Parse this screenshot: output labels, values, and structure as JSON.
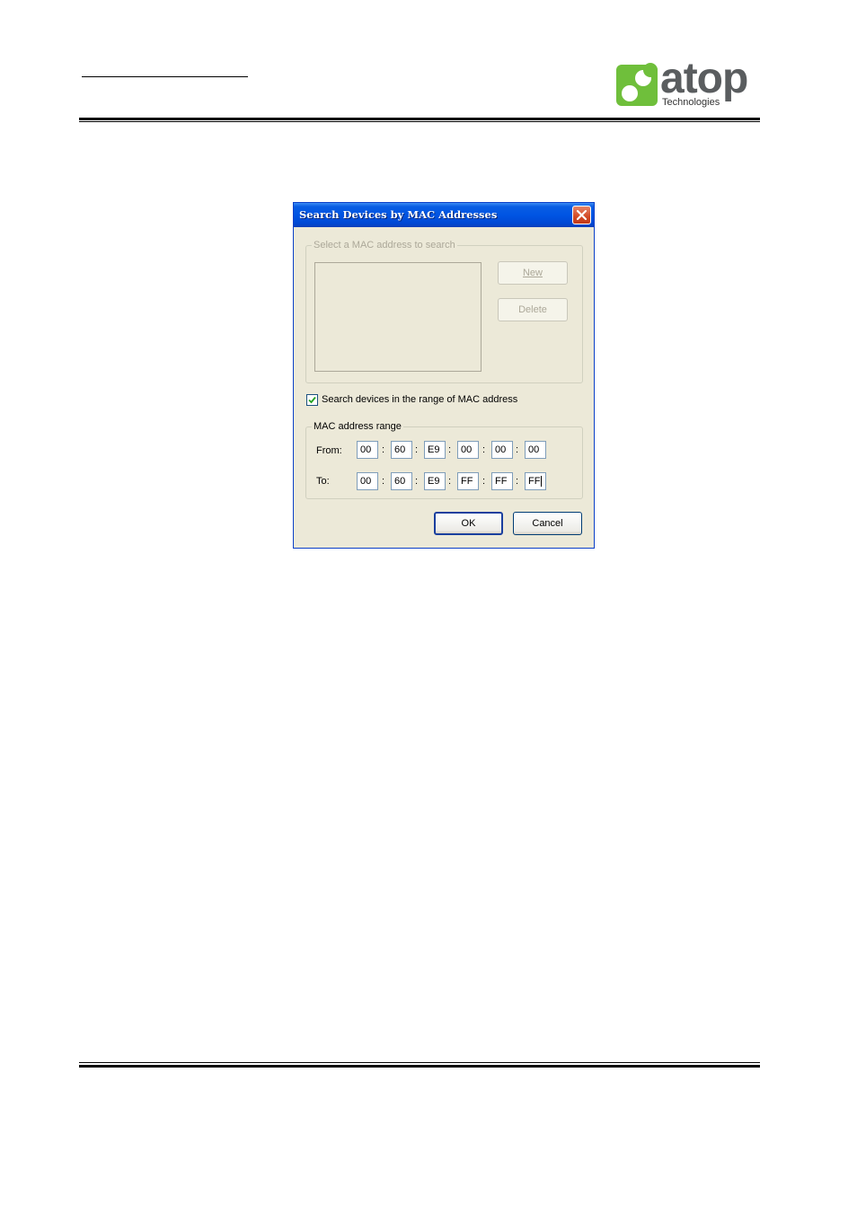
{
  "brand": {
    "logo_word": "atop",
    "logo_sub": "Technologies",
    "logo_green": "#6fbf3b"
  },
  "dialog": {
    "title": "Search Devices by MAC Addresses",
    "select_group_legend": "Select a MAC address to search",
    "new_label": "New",
    "delete_label": "Delete",
    "range_checkbox_label": "Search devices in the range of MAC address",
    "range_checked": true,
    "range_group_legend": "MAC address range",
    "from_label": "From:",
    "to_label": "To:",
    "separator": ":",
    "from_octets": [
      "00",
      "60",
      "E9",
      "00",
      "00",
      "00"
    ],
    "to_octets": [
      "00",
      "60",
      "E9",
      "FF",
      "FF",
      "FF"
    ],
    "ok_label": "OK",
    "cancel_label": "Cancel"
  }
}
